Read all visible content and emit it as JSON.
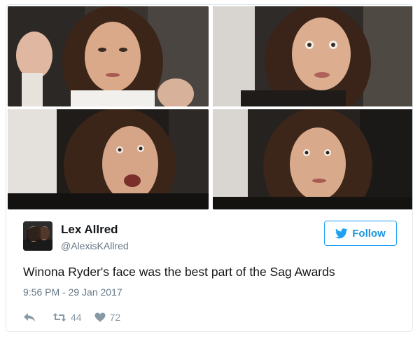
{
  "tweet": {
    "author_name": "Lex Allred",
    "author_handle": "@AlexisKAllred",
    "follow_label": "Follow",
    "text": "Winona Ryder's face was the best part of the Sag Awards",
    "timestamp": "9:56 PM - 29 Jan 2017",
    "retweet_count": "44",
    "like_count": "72"
  },
  "media": {
    "photos": [
      "top-left",
      "top-right",
      "bottom-left",
      "bottom-right"
    ]
  },
  "icons": {
    "reply": "reply-icon",
    "retweet": "retweet-icon",
    "like": "heart-icon",
    "bird": "twitter-bird-icon"
  },
  "colors": {
    "accent": "#1da1f2",
    "text": "#14171a",
    "secondary": "#657786",
    "action": "#8899a6",
    "border": "#e1e8ed"
  }
}
